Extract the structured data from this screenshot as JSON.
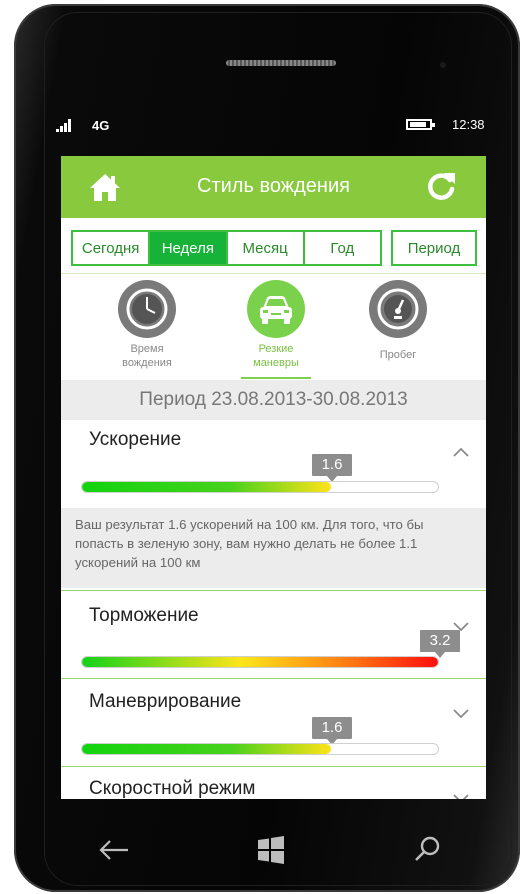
{
  "status": {
    "network": "4G",
    "time": "12:38"
  },
  "header": {
    "title": "Стиль вождения",
    "home_icon": "home-icon",
    "refresh_icon": "refresh-icon"
  },
  "tabs": [
    {
      "label": "Сегодня",
      "active": false
    },
    {
      "label": "Неделя",
      "active": true
    },
    {
      "label": "Месяц",
      "active": false
    },
    {
      "label": "Год",
      "active": false
    }
  ],
  "period_button": "Период",
  "categories": [
    {
      "label": "Время вождения",
      "icon": "clock-icon",
      "active": false
    },
    {
      "label": "Резкие маневры",
      "icon": "car-icon",
      "active": true
    },
    {
      "label": "Пробег",
      "icon": "speedometer-icon",
      "active": false
    }
  ],
  "period_text": "Период 23.08.2013-30.08.2013",
  "metrics": [
    {
      "title": "Ускорение",
      "value": "1.6",
      "level": 0.7,
      "expanded": true,
      "note": "Ваш результат 1.6 ускорений на 100 км. Для того, что бы попасть в зеленую зону, вам нужно делать не более 1.1 ускорений на 100 км"
    },
    {
      "title": "Торможение",
      "value": "3.2",
      "level": 1.0,
      "expanded": false
    },
    {
      "title": "Маневрирование",
      "value": "1.6",
      "level": 0.7,
      "expanded": false
    },
    {
      "title": "Скоростной режим",
      "expanded": false
    }
  ],
  "colors": {
    "accent": "#88c93e",
    "tab_border": "#3fbf3f",
    "tab_active": "#17b339"
  }
}
